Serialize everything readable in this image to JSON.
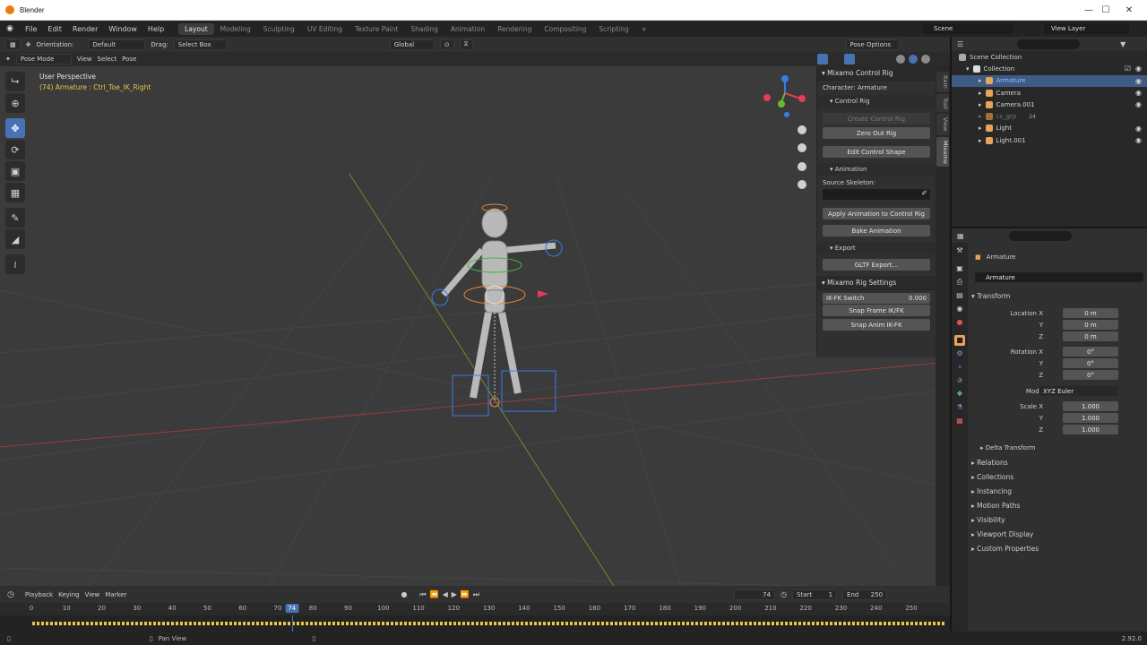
{
  "window": {
    "title": "Blender",
    "version": "2.92.0"
  },
  "menu": [
    "File",
    "Edit",
    "Render",
    "Window",
    "Help"
  ],
  "workspaces": [
    {
      "label": "Layout",
      "active": true
    },
    {
      "label": "Modeling"
    },
    {
      "label": "Sculpting"
    },
    {
      "label": "UV Editing"
    },
    {
      "label": "Texture Paint"
    },
    {
      "label": "Shading"
    },
    {
      "label": "Animation"
    },
    {
      "label": "Rendering"
    },
    {
      "label": "Compositing"
    },
    {
      "label": "Scripting"
    }
  ],
  "top_right": {
    "scene": "Scene",
    "view_layer": "View Layer"
  },
  "header": {
    "orientation_label": "Orientation:",
    "orientation_value": "Default",
    "drag_label": "Drag:",
    "drag_value": "Select Box",
    "transform_orientation": "Global",
    "pose_options": "Pose Options",
    "mode": "Pose Mode",
    "view_menu": [
      "View",
      "Select",
      "Pose"
    ]
  },
  "viewport": {
    "perspective": "User Perspective",
    "info": "(74) Armature : Ctrl_Toe_IK_Right"
  },
  "npanel": {
    "title": "Mixamo Control Rig",
    "character": "Character: Armature",
    "control_rig": "Control Rig",
    "create_control_rig": "Create Control Rig",
    "zero_out_rig": "Zero Out Rig",
    "edit_control_shape": "Edit Control Shape",
    "animation": "Animation",
    "source_skeleton": "Source Skeleton:",
    "apply_animation": "Apply Animation to Control Rig",
    "bake_animation": "Bake Animation",
    "export": "Export",
    "gltf_export": "GLTF Export...",
    "rig_settings": "Mixamo Rig Settings",
    "ikfk_switch": "IK-FK Switch",
    "ikfk_value": "0.000",
    "snap_frame": "Snap Frame IK/FK",
    "snap_anim": "Snap Anim IK-FK",
    "tabs": [
      "Item",
      "Tool",
      "View",
      "Mixamo"
    ]
  },
  "outliner": {
    "scene_collection": "Scene Collection",
    "collection": "Collection",
    "items": [
      {
        "name": "Armature",
        "selected": true,
        "color": "#e8a45a"
      },
      {
        "name": "Camera",
        "color": "#e8a45a"
      },
      {
        "name": "Camera.001",
        "color": "#e8a45a"
      },
      {
        "name": "cs_grp",
        "color": "#a07040",
        "dim": true,
        "badge": "24"
      },
      {
        "name": "Light",
        "color": "#e8a45a"
      },
      {
        "name": "Light.001",
        "color": "#e8a45a"
      }
    ]
  },
  "properties": {
    "object_name": "Armature",
    "data_name": "Armature",
    "transform": "Transform",
    "location_x_label": "Location X",
    "y_label": "Y",
    "z_label": "Z",
    "location": [
      "0 m",
      "0 m",
      "0 m"
    ],
    "rotation_x_label": "Rotation X",
    "rotation": [
      "0°",
      "0°",
      "0°"
    ],
    "mode_label": "Mode",
    "mode_value": "XYZ Euler",
    "scale_x_label": "Scale X",
    "scale": [
      "1.000",
      "1.000",
      "1.000"
    ],
    "delta_transform": "Delta Transform",
    "sections": [
      "Relations",
      "Collections",
      "Instancing",
      "Motion Paths",
      "Visibility",
      "Viewport Display",
      "Custom Properties"
    ]
  },
  "timeline": {
    "menus": [
      "Playback",
      "Keying",
      "View",
      "Marker"
    ],
    "current_frame": "74",
    "start_label": "Start",
    "start": "1",
    "end_label": "End",
    "end": "250",
    "ticks": [
      "0",
      "10",
      "20",
      "30",
      "40",
      "50",
      "60",
      "70",
      "74",
      "80",
      "90",
      "100",
      "110",
      "120",
      "130",
      "140",
      "150",
      "160",
      "170",
      "180",
      "190",
      "200",
      "210",
      "220",
      "230",
      "240",
      "250"
    ]
  },
  "status": {
    "pan_view": "Pan View"
  },
  "colors": {
    "accent": "#4772b3",
    "selected_row": "#3e5b85",
    "header_bg": "#303030"
  }
}
